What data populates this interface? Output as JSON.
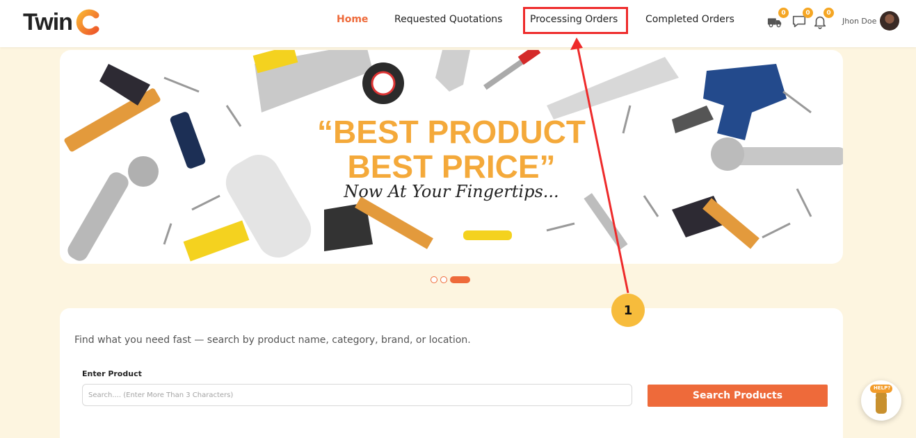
{
  "header": {
    "logo_text": "Twin",
    "nav": [
      {
        "label": "Home",
        "active": true
      },
      {
        "label": "Requested Quotations",
        "active": false
      },
      {
        "label": "Processing Orders",
        "active": false
      },
      {
        "label": "Completed Orders",
        "active": false
      }
    ],
    "icons": [
      {
        "name": "delivery-truck-icon",
        "badge": "0"
      },
      {
        "name": "chat-icon",
        "badge": "0"
      },
      {
        "name": "bell-icon",
        "badge": "0"
      }
    ],
    "user_name": "Jhon Doe"
  },
  "banner": {
    "title_line1": "“BEST PRODUCT",
    "title_line2": "BEST PRICE”",
    "tagline": "Now At Your Fingertips...",
    "slides": 3,
    "active_slide": 3,
    "title_color": "#f4a93a"
  },
  "search": {
    "description": "Find what you need fast — search by product name, category, brand, or location.",
    "label": "Enter Product",
    "placeholder": "Search.... (Enter More Than 3 Characters)",
    "value": "",
    "button_label": "Search Products"
  },
  "annotation": {
    "number": "1",
    "box_color": "#ee2a2a",
    "circle_color": "#f7bc3c"
  },
  "help_label": "HELP?",
  "colors": {
    "accent": "#ee6a3a",
    "page_bg": "#fdf5e0"
  }
}
